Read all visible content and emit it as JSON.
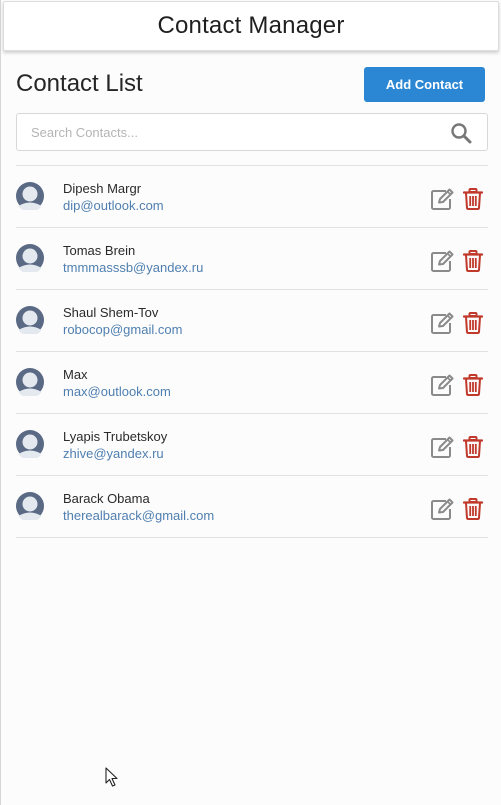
{
  "header": {
    "title": "Contact Manager"
  },
  "page": {
    "title": "Contact List"
  },
  "toolbar": {
    "add_label": "Add Contact"
  },
  "search": {
    "placeholder": "Search Contacts...",
    "value": ""
  },
  "colors": {
    "accent": "#2b87d3",
    "email": "#4f7fb0",
    "delete": "#c0392b",
    "avatar": "#5a6a85"
  },
  "icons": {
    "search": "search-icon",
    "avatar": "avatar-icon",
    "edit": "edit-icon",
    "delete": "trash-icon"
  },
  "contacts": [
    {
      "name": "Dipesh Margr",
      "email": "dip@outlook.com"
    },
    {
      "name": "Tomas Brein",
      "email": "tmmmasssb@yandex.ru"
    },
    {
      "name": "Shaul Shem-Tov",
      "email": "robocop@gmail.com"
    },
    {
      "name": "Max",
      "email": "max@outlook.com"
    },
    {
      "name": "Lyapis Trubetskoy",
      "email": "zhive@yandex.ru"
    },
    {
      "name": "Barack Obama",
      "email": "therealbarack@gmail.com"
    }
  ]
}
